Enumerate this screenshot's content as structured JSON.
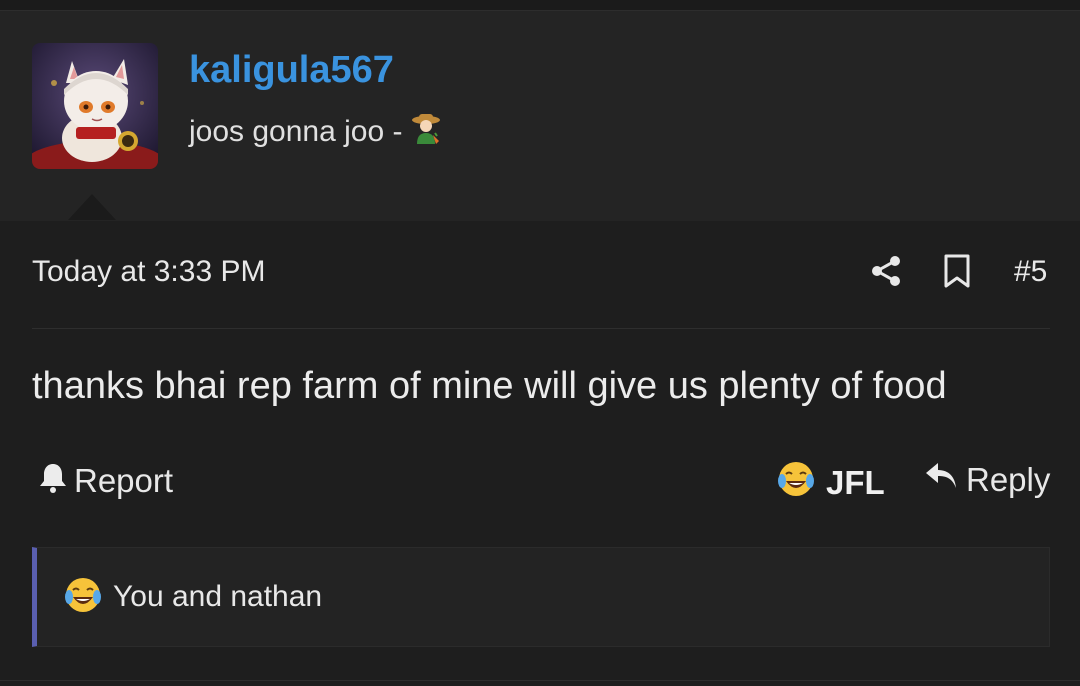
{
  "user": {
    "username": "kaligula567",
    "title": "joos gonna joo -",
    "title_icon": "farmer-emoji-icon",
    "avatar": "anime-cat-girl-figure-avatar"
  },
  "post": {
    "date": "Today at 3:33 PM",
    "number": "#5",
    "message": "thanks bhai rep farm of mine will give us plenty of food"
  },
  "actions": {
    "report_label": "Report",
    "reaction_label": "JFL",
    "reply_label": "Reply"
  },
  "reactions": {
    "text": "You and nathan",
    "icon": "crying-laughing-emoji-icon"
  },
  "colors": {
    "username": "#3a93df",
    "reaction_bar_accent": "#5a5fb0",
    "background": "#1b1b1b"
  }
}
